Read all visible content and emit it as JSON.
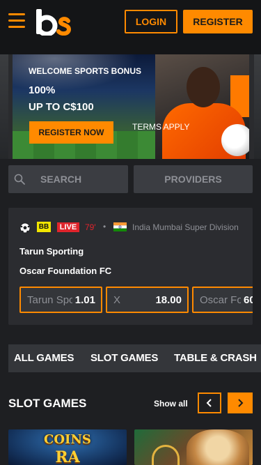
{
  "header": {
    "logo_text": "bs",
    "login_label": "LOGIN",
    "register_label": "REGISTER",
    "accent": "#ff8a00"
  },
  "banner": {
    "title": "WELCOME SPORTS BONUS",
    "line1": "100%",
    "line2": "UP TO C$100",
    "cta_label": "REGISTER NOW",
    "terms_label": "TERMS APPLY"
  },
  "search": {
    "placeholder": "SEARCH",
    "providers_label": "PROVIDERS"
  },
  "match": {
    "sport_icon": "soccer-ball-icon",
    "bb_badge": "BB",
    "live_badge": "LIVE",
    "minute": "79'",
    "separator": "•",
    "country_flag": "india-flag-icon",
    "league": "India Mumbai Super Division",
    "team_home": "Tarun Sporting",
    "team_away": "Oscar Foundation FC",
    "odds": [
      {
        "label": "Tarun Sporting",
        "value": "1.01"
      },
      {
        "label": "X",
        "value": "18.00"
      },
      {
        "label": "Oscar Foundation FC",
        "value": "60"
      }
    ]
  },
  "tabs": [
    {
      "label": "ALL GAMES"
    },
    {
      "label": "SLOT GAMES"
    },
    {
      "label": "TABLE & CRASH"
    }
  ],
  "slot_section": {
    "title": "SLOT GAMES",
    "show_all_label": "Show all",
    "games": [
      {
        "title": "COINS",
        "subtitle": "RA"
      },
      {
        "title": ""
      }
    ]
  }
}
